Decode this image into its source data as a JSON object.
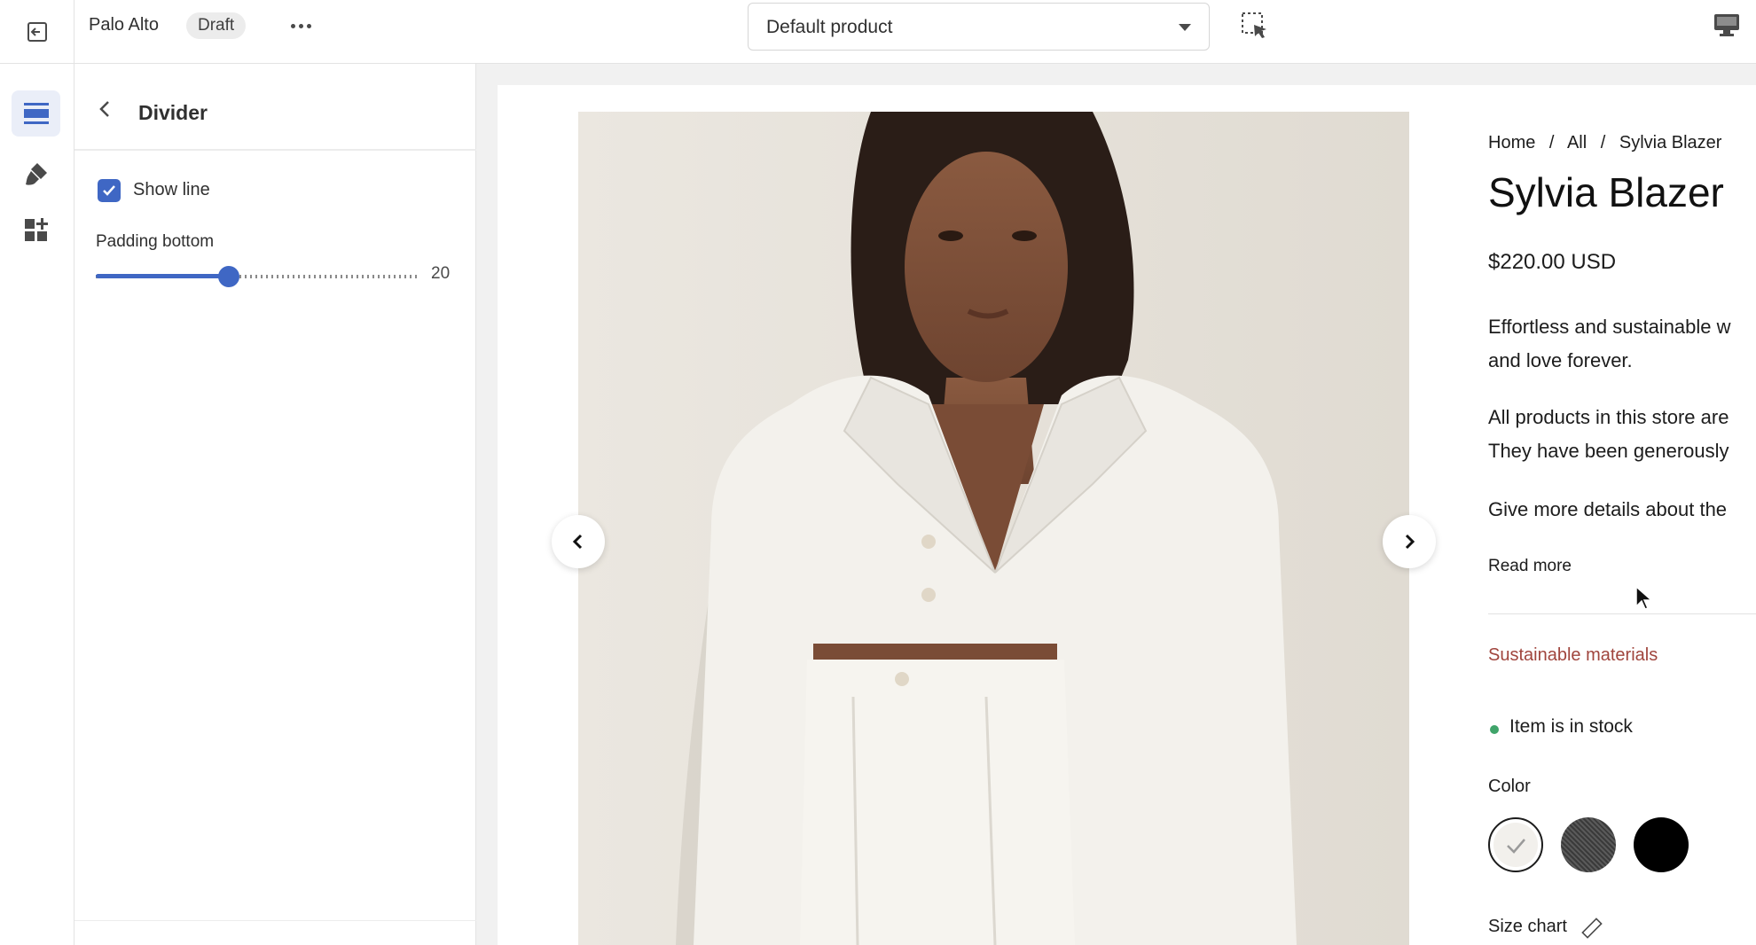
{
  "topbar": {
    "store_name": "Palo Alto",
    "status_badge": "Draft",
    "template_select": "Default product"
  },
  "panel": {
    "title": "Divider",
    "show_line_label": "Show line",
    "show_line_checked": true,
    "padding_label": "Padding bottom",
    "padding_value": "20",
    "padding_fraction": 0.41
  },
  "product": {
    "breadcrumb": [
      "Home",
      "/",
      "All",
      "/",
      "Sylvia Blazer"
    ],
    "title": "Sylvia Blazer",
    "price": "$220.00 USD",
    "description_lines": [
      "Effortless and sustainable w",
      "and love forever.",
      "All products in this store are",
      "They have been generously",
      "Give more details about the"
    ],
    "read_more": "Read more",
    "sustainable_link": "Sustainable materials",
    "stock_status": "Item is in stock",
    "color_label": "Color",
    "swatches": [
      {
        "name": "white",
        "color": "#f2f0ec",
        "selected": true
      },
      {
        "name": "grey",
        "color": "#4a4a4a",
        "selected": false
      },
      {
        "name": "black",
        "color": "#000000",
        "selected": false
      }
    ],
    "size_chart": "Size chart"
  },
  "colors": {
    "accent": "#3f67c4",
    "stock_dot": "#3fa46a",
    "sustain_text": "#a0453d"
  }
}
